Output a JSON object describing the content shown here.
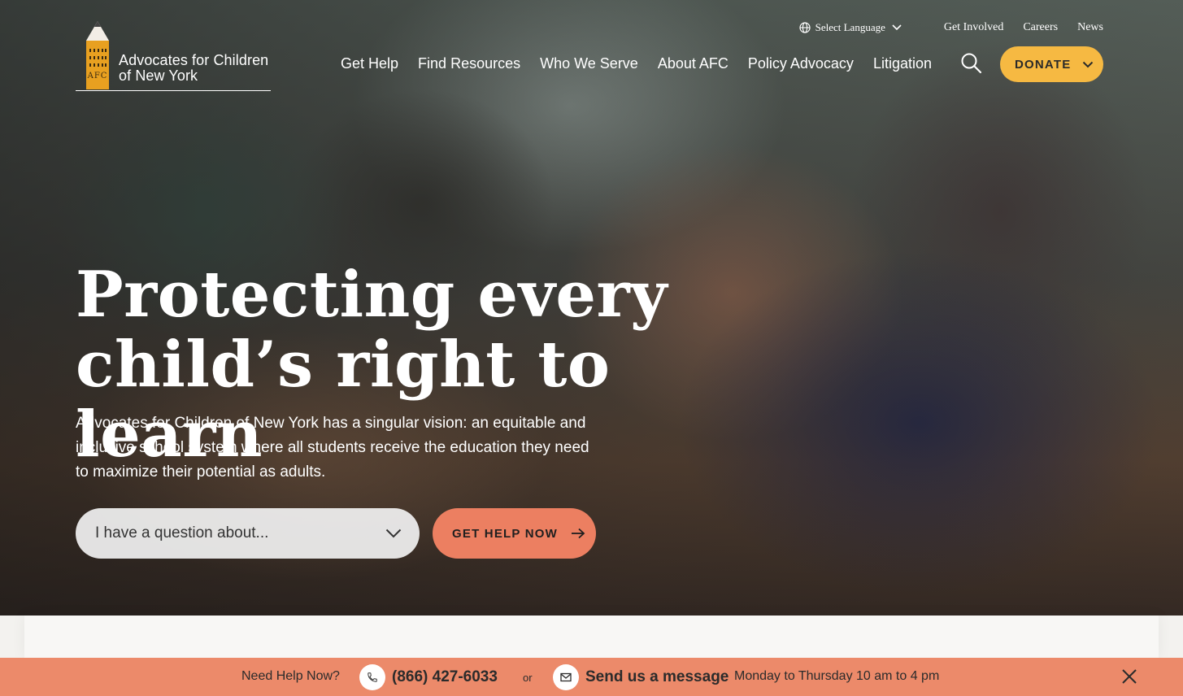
{
  "header": {
    "logo_line1": "Advocates for Children",
    "logo_line2": "of New York",
    "logo_badge": "AFC",
    "language_label": "Select Language",
    "utility_links": [
      "Get Involved",
      "Careers",
      "News"
    ],
    "nav_items": [
      "Get Help",
      "Find Resources",
      "Who We Serve",
      "About AFC",
      "Policy Advocacy",
      "Litigation"
    ],
    "donate_label": "DONATE"
  },
  "hero": {
    "headline_line1": "Protecting every",
    "headline_line2": "child’s right to learn",
    "intro": "Advocates for Children of New York has a singular vision: an equitable and inclusive school system where all students receive the education they need to maximize their potential as adults.",
    "select_placeholder": "I have a question about...",
    "cta_label": "GET HELP NOW"
  },
  "help_bar": {
    "need_help": "Need Help Now?",
    "phone": "(866) 427-6033",
    "or": "or",
    "message": "Send us a message",
    "hours": "Monday to Thursday 10 am to 4 pm"
  },
  "colors": {
    "donate": "#f6b942",
    "cta": "#ec7f61",
    "help_bar": "#ec8a6a",
    "logo_pencil": "#e8a020"
  },
  "icons": [
    "globe-icon",
    "chevron-down-icon",
    "search-icon",
    "arrow-right-icon",
    "phone-icon",
    "mail-icon",
    "close-icon"
  ]
}
